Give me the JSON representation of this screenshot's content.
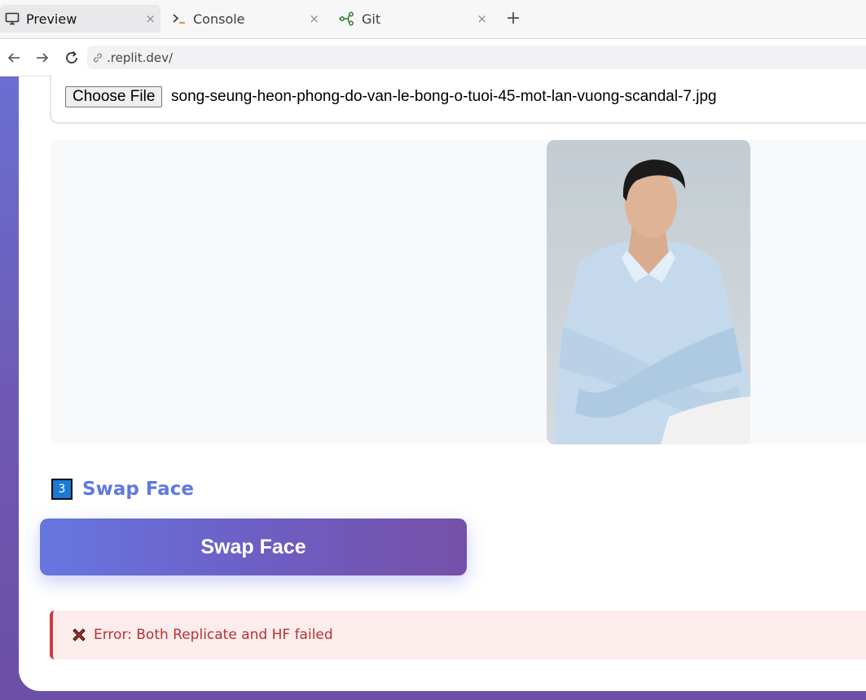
{
  "tabs": [
    {
      "label": "Preview",
      "icon": "monitor-icon",
      "active": true
    },
    {
      "label": "Console",
      "icon": "terminal-icon",
      "active": false
    },
    {
      "label": "Git",
      "icon": "git-icon",
      "active": false
    }
  ],
  "tab_close_glyph": "×",
  "tab_add_glyph": "+",
  "address": {
    "url": ".replit.dev/"
  },
  "upload": {
    "button_label": "Choose File",
    "file_name": "song-seung-heon-phong-do-van-le-bong-o-tuoi-45-mot-lan-vuong-scandal-7.jpg"
  },
  "step": {
    "number": "3",
    "title": "Swap Face"
  },
  "swap_button": {
    "label": "Swap Face"
  },
  "error": {
    "message": "Error: Both Replicate and HF failed"
  },
  "colors": {
    "accent": "#6079df",
    "error": "#b23333",
    "badge": "#1a7ad6"
  }
}
